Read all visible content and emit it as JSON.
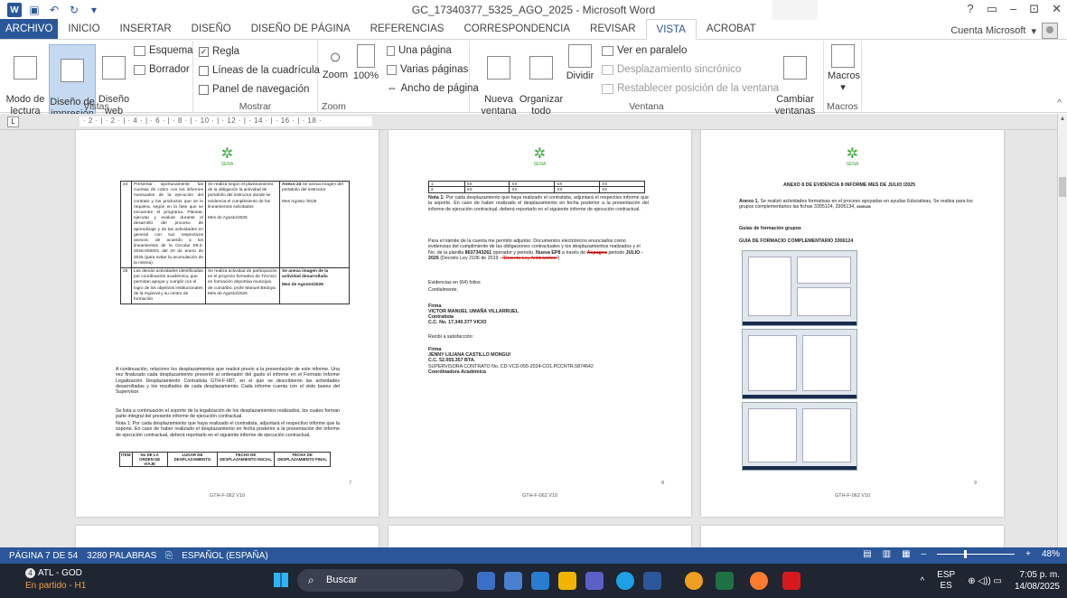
{
  "window": {
    "title": "GC_17340377_5325_AGO_2025 - Microsoft Word",
    "controls": [
      "?",
      "▭",
      "–",
      "⊡",
      "✕"
    ]
  },
  "tabs": [
    {
      "label": "ARCHIVO"
    },
    {
      "label": "INICIO"
    },
    {
      "label": "INSERTAR"
    },
    {
      "label": "DISEÑO"
    },
    {
      "label": "DISEÑO DE PÁGINA"
    },
    {
      "label": "REFERENCIAS"
    },
    {
      "label": "CORRESPONDENCIA"
    },
    {
      "label": "REVISAR"
    },
    {
      "label": "VISTA"
    },
    {
      "label": "ACROBAT"
    }
  ],
  "account": "Cuenta Microsoft",
  "ribbon": {
    "vistas": {
      "label": "Vistas",
      "modo_lectura": "Modo de\nlectura",
      "diseno_impresion": "Diseño de\nimpresión",
      "diseno_web": "Diseño\nweb",
      "esquema": "Esquema",
      "borrador": "Borrador"
    },
    "mostrar": {
      "label": "Mostrar",
      "regla": "Regla",
      "lineas": "Líneas de la cuadrícula",
      "panel": "Panel de navegación"
    },
    "zoom": {
      "label": "Zoom",
      "zoom": "Zoom",
      "pct": "100%",
      "una_pagina": "Una página",
      "varias": "Varias páginas",
      "ancho": "Ancho de página"
    },
    "ventana": {
      "label": "Ventana",
      "nueva": "Nueva\nventana",
      "organizar": "Organizar\ntodo",
      "dividir": "Dividir",
      "paralelo": "Ver en paralelo",
      "sincronico": "Desplazamiento sincrónico",
      "restablecer": "Restablecer posición de la ventana",
      "cambiar": "Cambiar\nventanas ▾"
    },
    "macros": {
      "label": "Macros",
      "macros": "Macros"
    }
  },
  "ruler": {
    "button": "L",
    "marks": "· 2 · | · 2 · | · 4 · | · 6 · | · 8 · | · 10 · | · 12 · | · 14 · | · 16 · | · 18 ·"
  },
  "pages": [
    {
      "number": "7",
      "footer": "GTH-F-062 V10",
      "logo_text": "SENA",
      "table": [
        {
          "num": "24",
          "desc": "Presentar oportunamente las cuentas de cobro con los informes mensuales de la ejecución del contrato y los productos que se le requiera, según en la fase que se encuentre el programa. Planear, ejecutar y evaluar durante el desarrollo del proceso de aprendizaje y de las actividades en general con sus respectivos anexos, de acuerdo a los lineamientos de la Circular 09-2-2025-000001 del 20 de enero de 2025 (para evitar la acumulación de la misma)",
          "activity": "Se realiza según el planteamiento de la obligación la actividad de portafolio del instructor donde se evidencia el cumplimiento de los lineamientos solicitados\n\nMes de Agosto/2025",
          "evidence_head": "Anexo 24",
          "evidence": "Se anexa imagen del portafolio del instructor\n\nMes Agosto /2025"
        },
        {
          "num": "25",
          "desc": "Las demás actividades identificadas por coordinación académica, que permitan apoyar y cumplir con el logro de los objetivos institucionales de la regional y su centro de formación",
          "activity": "Se realiza actividad de participación en el proyecto formativo de Técnico en formación deportiva municipio de cumaribo, profe Manuel Bedoya Mes de Agosto/2025",
          "evidence_head": "Se anexa imagen de la actividad desarrollada",
          "evidence": "Mes de Agosto/2026"
        }
      ],
      "para1": "A continuación, relaciono los desplazamientos que realicé previo a la presentación de este informe. Una vez finalizado cada desplazamiento presenté al ordenador del gasto el informe en el Formato Informe Legalización Desplazamiento Contratista GTH-F-087, en el que se describieron las actividades desarrolladas y los resultados de cada desplazamiento. Cada informe cuenta con el visto bueno del Supervisor.",
      "para2": "Se lista a continuación el soporte de la legalización de los desplazamientos realizados, los cuales forman parte integral del presente informe de ejecución contractual.",
      "para3": "Nota 1: Por cada desplazamiento que haya realizado el contratista, adjuntará el respectivo informe que la soporte. En caso de haber realizado el desplazamiento en fecha posterior a la presentación del informe de ejecución contractual, deberá reportarlo en el siguiente informe de ejecución contractual.",
      "headers": [
        "ITEM",
        "No DE LA ORDEN DE VIAJE",
        "LUGAR DE DESPLAZAMIENTO",
        "FECHA DE DESPLAZAMIENTO INICIAL",
        "FECHA DE DESPLAZAMIENTO FINAL"
      ]
    },
    {
      "number": "8",
      "footer": "GTH-F-062 V10",
      "logo_text": "SENA",
      "rows": [
        [
          "1.",
          "XX",
          "XX",
          "XX",
          "XX"
        ],
        [
          "2.",
          "XX",
          "XX",
          "XX",
          "XX"
        ]
      ],
      "nota_head": "Nota 1:",
      "nota": "Por cada desplazamiento que haya realizado el contratista, adjuntará el respectivo informe que la soporte. En caso de haber realizado el desplazamiento en fecha posterior a la presentación del informe de ejecución contractual, deberá reportarlo en el siguiente informe de ejecución contractual.",
      "tramite": "Para el trámite de la cuenta me permito adjuntar: Documentos electrónicos enunciados como evidencias del cumplimiento de las obligaciones contractuales y los desplazamientos realizados y el No. de la planilla",
      "planilla": "8637343261",
      "tramite2": "operador y periodo.",
      "ep": "Nueva EP8",
      "tramite3": "a través de",
      "struck1": "Aspagos",
      "tramite4": "periodo",
      "periodo": "JULIO - 2026",
      "tramite5": "(Decreto Ley 2106 de 2019 –",
      "struck2": "\"Decreto Ley Antitrámites\"",
      "tramite6": ")",
      "folios": "Evidencias en (64) folios",
      "cordial": "Cordialmente,",
      "firma1_label": "Firma",
      "firma1_name": "VICTOR MANUEL UMAÑA VILLARRUEL",
      "firma1_role": "Contratista",
      "firma1_cc": "C.C. No. 17.340.377 VICIO",
      "recibi": "Recibí a satisfacción:",
      "firma2_label": "Firma",
      "firma2_name": "JENNY LILIANA CASTILLO MONGUI",
      "firma2_cc": "C.C. 52.055.357 BTA.",
      "firma2_role": "SUPERVISORA CONTRATO No. CD-VCD-055-2024-CO1.PCCNTR.5874642",
      "firma2_role2": "Coordinadora Académica"
    },
    {
      "number": "9",
      "footer": "GTH-F-062 V10",
      "logo_text": "SENA",
      "title": "ANEXO 8 DE EVIDENCIA 8 INFORME MES DE JULIO /2025",
      "anexo_head": "Anexo 1.",
      "anexo": "Se realizó actividades formativas en el proceso apoyadas en ayudas Educativas, Se realiza para los grupos complementarios las fichas 3305124, 3305134,",
      "anexo_tail": "3305138",
      "guias": "Guias de formación grupos",
      "guia_title": "GUIA DE FORMACIO COMPLEMENTARIO 3306124"
    }
  ],
  "status": {
    "page": "PÁGINA 7 DE 54",
    "words": "3280 PALABRAS",
    "lang": "ESPAÑOL (ESPAÑA)",
    "zoom": "48%",
    "zoom_minus": "–",
    "zoom_plus": "+"
  },
  "taskbar": {
    "notif_count": "4",
    "app": "ATL - GOD",
    "app_sub": "En partido - H1",
    "search": "Buscar",
    "lang1": "ESP",
    "lang2": "ES",
    "time": "7:05 p. m.",
    "date": "14/08/2025",
    "tray_caret": "^",
    "tray_icons": "⊕ ◁)) ▭"
  },
  "colors": {
    "word_blue": "#2b579a",
    "taskbar": "#1f2531",
    "sena_green": "#39a935"
  }
}
